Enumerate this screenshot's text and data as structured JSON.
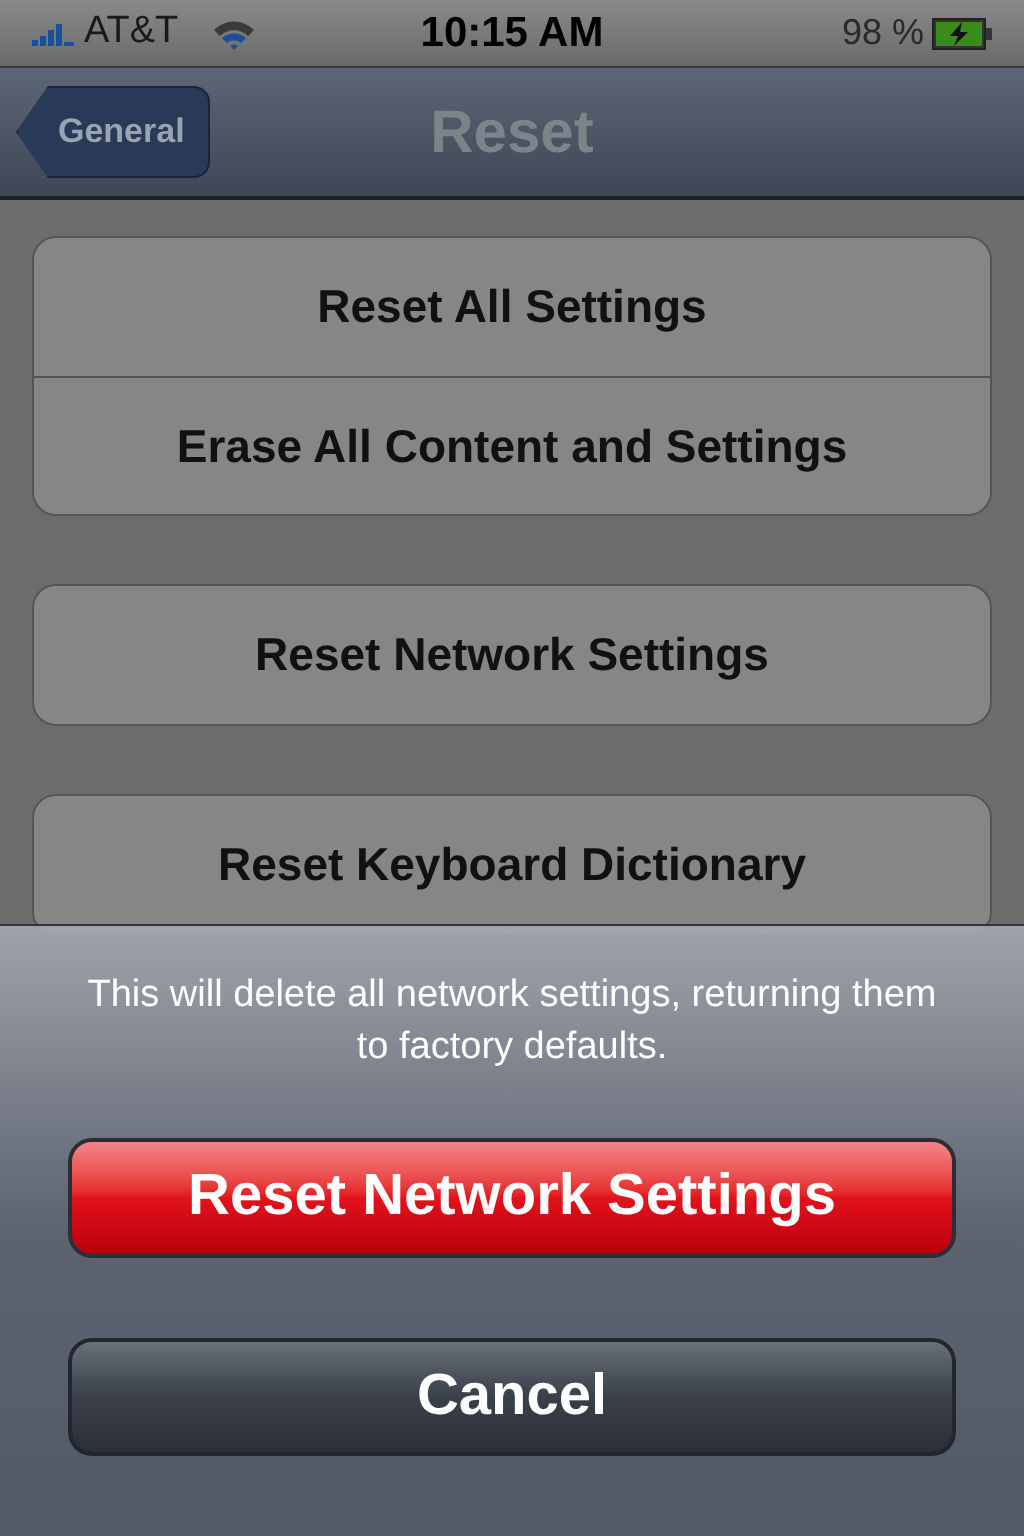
{
  "status_bar": {
    "carrier": "AT&T",
    "time": "10:15 AM",
    "battery": "98 %",
    "charging": true
  },
  "nav_bar": {
    "back": "General",
    "title": "Reset"
  },
  "groups": [
    {
      "items": [
        "Reset All Settings",
        "Erase All Content and Settings"
      ]
    },
    {
      "items": [
        "Reset Network Settings"
      ]
    },
    {
      "items": [
        "Reset Keyboard Dictionary"
      ]
    }
  ],
  "action_sheet": {
    "message": "This will delete all network settings, returning them to factory defaults.",
    "buttons": [
      {
        "label": "Reset Network Settings",
        "kind": "destructive"
      },
      {
        "label": "Cancel",
        "kind": "cancel"
      }
    ]
  }
}
